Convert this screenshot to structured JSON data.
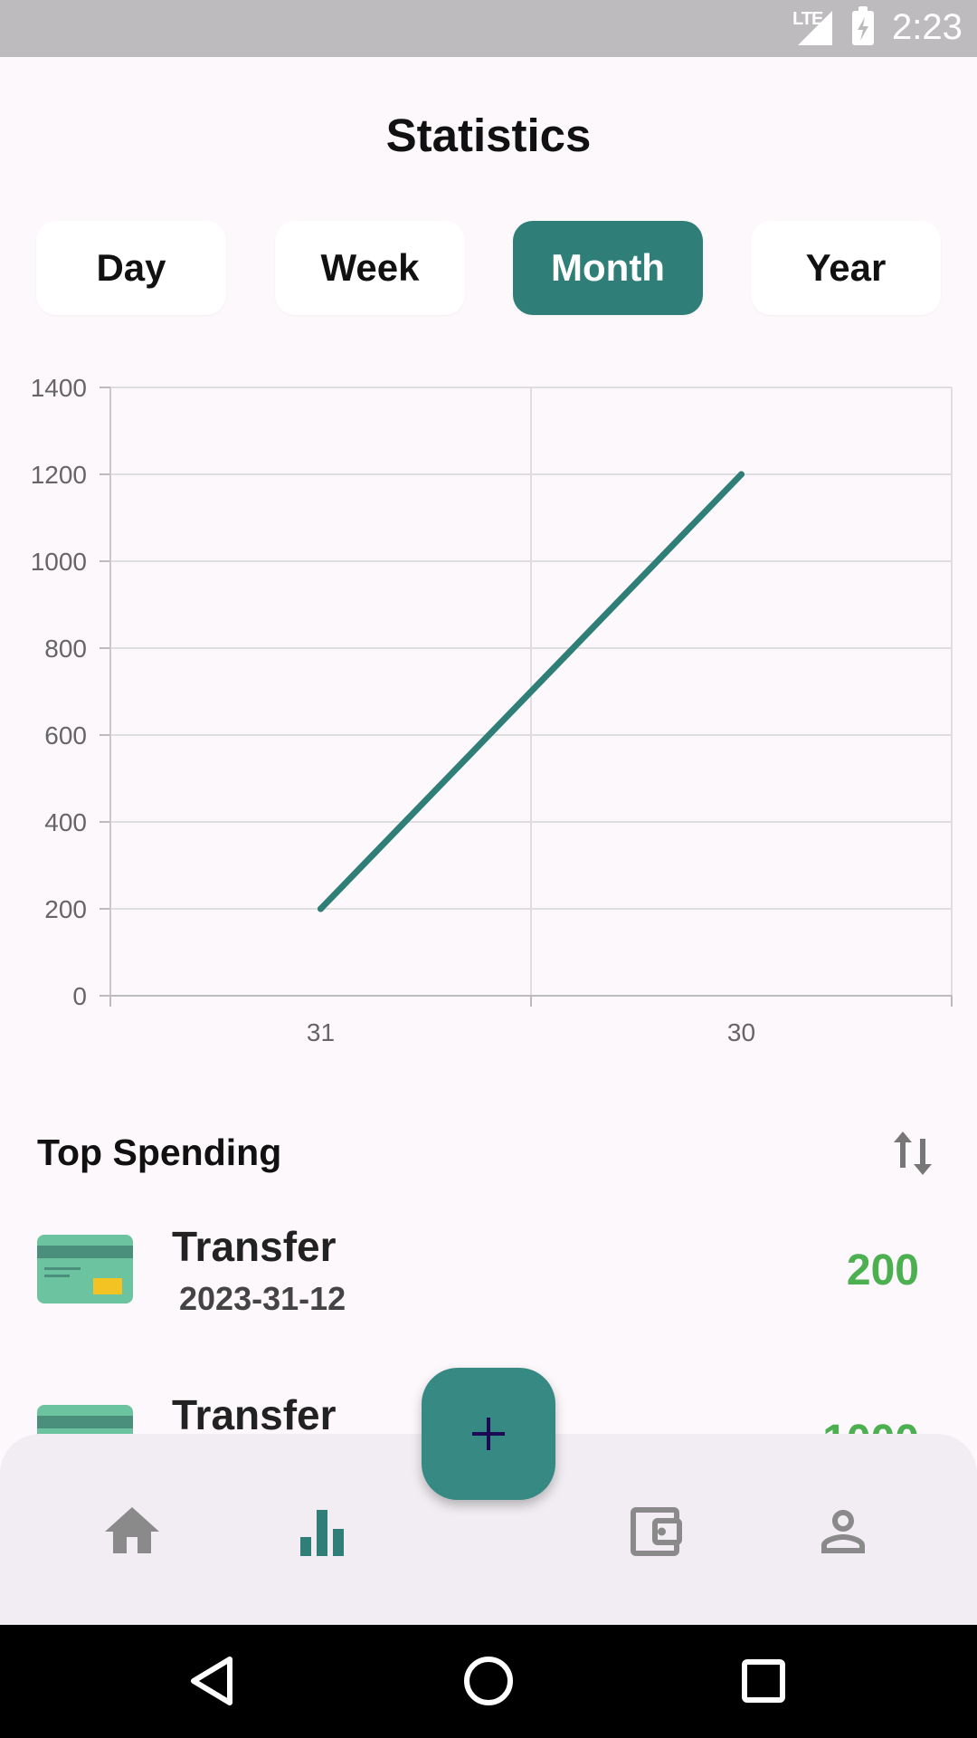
{
  "status_bar": {
    "network": "LTE",
    "time": "2:23"
  },
  "page": {
    "title": "Statistics"
  },
  "tabs": [
    {
      "label": "Day",
      "active": false
    },
    {
      "label": "Week",
      "active": false
    },
    {
      "label": "Month",
      "active": true
    },
    {
      "label": "Year",
      "active": false
    }
  ],
  "chart_data": {
    "type": "line",
    "x": [
      "31",
      "30"
    ],
    "series": [
      {
        "values": [
          200,
          1200
        ],
        "color": "#2f7f78"
      }
    ],
    "ylim": [
      0,
      1400
    ],
    "yticks": [
      "0",
      "200",
      "400",
      "600",
      "800",
      "1000",
      "1200",
      "1400"
    ],
    "grid": true
  },
  "top_spending": {
    "title": "Top Spending",
    "items": [
      {
        "title": "Transfer",
        "date": "2023-31-12",
        "amount": "200"
      },
      {
        "title": "Transfer",
        "date": "",
        "amount": "1000"
      }
    ]
  },
  "bottom_nav": {
    "items": [
      {
        "icon": "home-icon",
        "active": false
      },
      {
        "icon": "bar-chart-icon",
        "active": true
      },
      {
        "icon": "wallet-icon",
        "active": false
      },
      {
        "icon": "profile-icon",
        "active": false
      }
    ],
    "fab_icon": "plus-icon"
  },
  "colors": {
    "accent": "#2f7f78",
    "amount": "#4caf50",
    "card": "#6cc3a0"
  }
}
